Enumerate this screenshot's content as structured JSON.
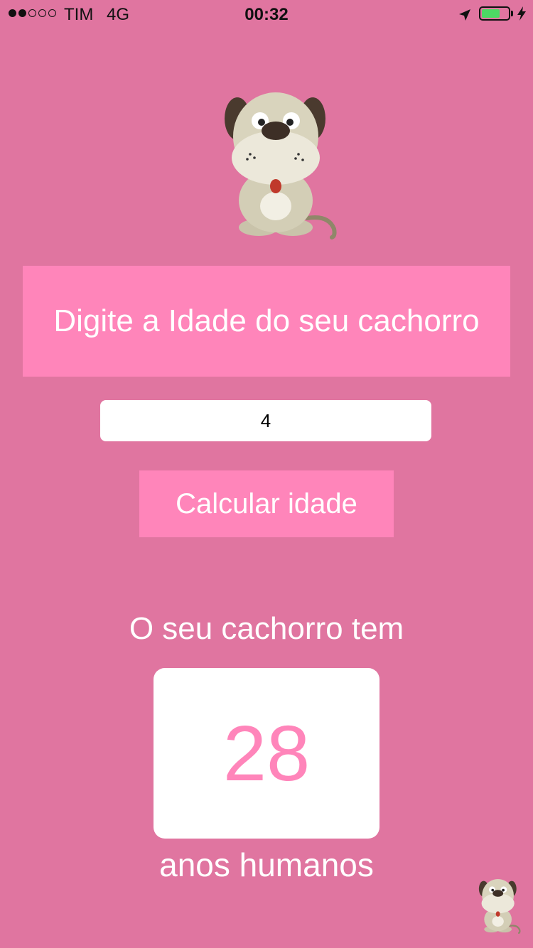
{
  "status_bar": {
    "carrier": "TIM",
    "network": "4G",
    "time": "00:32",
    "signal_bars_filled": 2,
    "signal_bars_total": 5,
    "battery_level": 0.7
  },
  "main": {
    "prompt": "Digite a Idade do seu cachorro",
    "age_input_value": "4",
    "calculate_button": "Calcular idade",
    "result_prefix": "O seu cachorro tem",
    "result_value": "28",
    "result_suffix": "anos humanos"
  },
  "colors": {
    "background": "#e075a0",
    "accent": "#ff85ba"
  },
  "icons": {
    "location": "location-arrow-icon",
    "charging": "bolt-icon",
    "mascot": "dog-icon"
  }
}
